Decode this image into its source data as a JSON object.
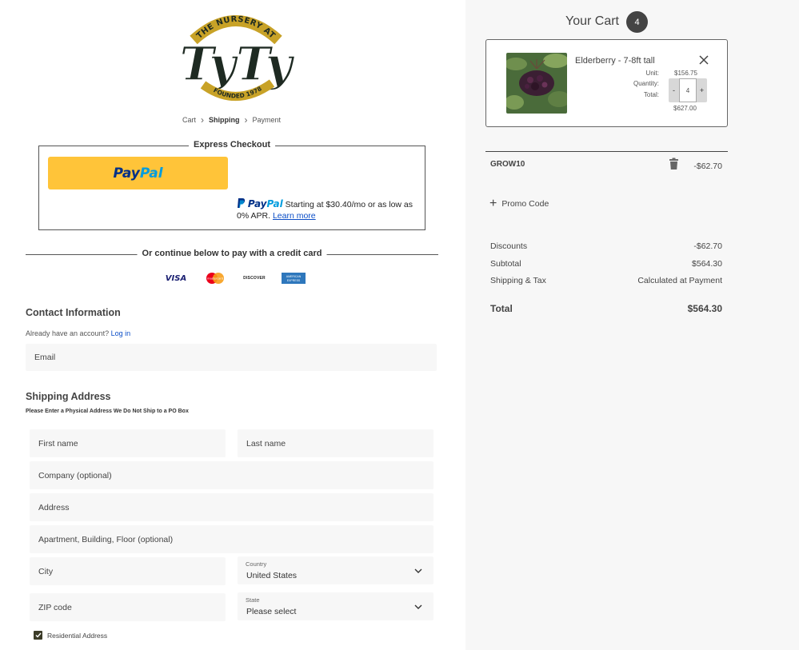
{
  "logo": {
    "arc_text": "THE NURSERY AT",
    "main_text": "TyTy",
    "founded_text": "FOUNDED 1978"
  },
  "breadcrumb": {
    "items": [
      "Cart",
      "Shipping",
      "Payment"
    ],
    "active": "Shipping"
  },
  "express_checkout": {
    "title": "Express Checkout",
    "paypal_button": {
      "pay": "Pay",
      "pal": "Pal"
    },
    "paypal_message": {
      "brand_pay": "Pay",
      "brand_pal": "Pal",
      "text": "Starting at $30.40/mo or as low as 0% APR.",
      "link": "Learn more"
    }
  },
  "divider_text": "Or continue below to pay with a credit card",
  "cards": {
    "visa": "VISA",
    "mastercard": "mastercard",
    "discover": "DISCOVER",
    "amex": "AMERICAN EXPRESS"
  },
  "contact": {
    "heading": "Contact Information",
    "account_prompt": "Already have an account?",
    "login_link": "Log in",
    "email_placeholder": "Email"
  },
  "shipping": {
    "heading": "Shipping Address",
    "note": "Please Enter a Physical Address We Do Not Ship to a PO Box",
    "first_name": "First name",
    "last_name": "Last name",
    "company": "Company (optional)",
    "address": "Address",
    "apartment": "Apartment, Building, Floor (optional)",
    "city": "City",
    "country_label": "Country",
    "country_value": "United States",
    "zip": "ZIP code",
    "state_label": "State",
    "state_value": "Please select",
    "residential_label": "Residential Address",
    "residential_checked": true
  },
  "cart": {
    "title": "Your Cart",
    "count": "4",
    "item": {
      "name": "Elderberry - 7-8ft tall",
      "unit_label": "Unit:",
      "unit_price": "$156.75",
      "quantity_label": "Quantity:",
      "quantity": "4",
      "total_label": "Total:",
      "total": "$627.00",
      "minus": "-",
      "plus": "+"
    },
    "promo": {
      "code": "GROW10",
      "amount": "-$62.70",
      "add_label": "Promo Code"
    },
    "summary": {
      "discounts_label": "Discounts",
      "discounts_value": "-$62.70",
      "subtotal_label": "Subtotal",
      "subtotal_value": "$564.30",
      "shipping_label": "Shipping & Tax",
      "shipping_value": "Calculated at Payment",
      "total_label": "Total",
      "total_value": "$564.30"
    }
  },
  "colors": {
    "paypal_yellow": "#ffc439",
    "paypal_dark_blue": "#003087",
    "paypal_light_blue": "#009cde",
    "link_blue": "#0a4dc7",
    "logo_dark": "#1e2a22",
    "logo_gold": "#c8a227",
    "panel_bg": "#f7f7f7"
  }
}
